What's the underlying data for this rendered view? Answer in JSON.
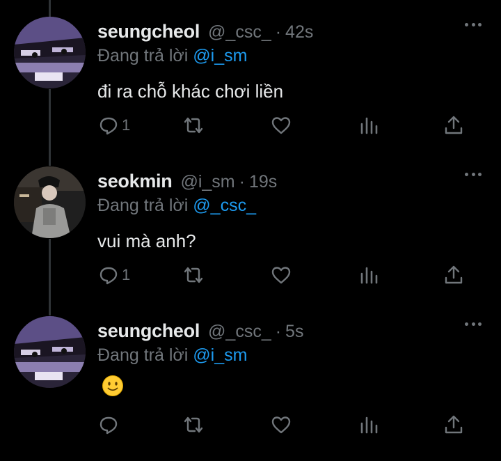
{
  "tweets": [
    {
      "display_name": "seungcheol",
      "handle": "@_csc_",
      "separator": "·",
      "time": "42s",
      "reply_prefix": "Đang trả lời",
      "reply_to": "@i_sm",
      "text": "đi ra chỗ khác chơi liền",
      "reply_count": "1",
      "avatar": "purple-toned-face-photo",
      "icons": [
        "reply-icon",
        "retweet-icon",
        "like-icon",
        "views-icon",
        "share-icon",
        "more-icon"
      ]
    },
    {
      "display_name": "seokmin",
      "handle": "@i_sm",
      "separator": "·",
      "time": "19s",
      "reply_prefix": "Đang trả lời",
      "reply_to": "@_csc_",
      "text": "vui mà anh?",
      "reply_count": "1",
      "avatar": "person-with-cap-photo"
    },
    {
      "display_name": "seungcheol",
      "handle": "@_csc_",
      "separator": "·",
      "time": "5s",
      "reply_prefix": "Đang trả lời",
      "reply_to": "@i_sm",
      "emoji": "slightly-smiling-face",
      "reply_count": "",
      "avatar": "purple-toned-face-photo"
    }
  ],
  "colors": {
    "background": "#000000",
    "text": "#e7e9ea",
    "muted": "#71767b",
    "mention": "#1d9bf0",
    "thread_line": "#2f3336"
  }
}
